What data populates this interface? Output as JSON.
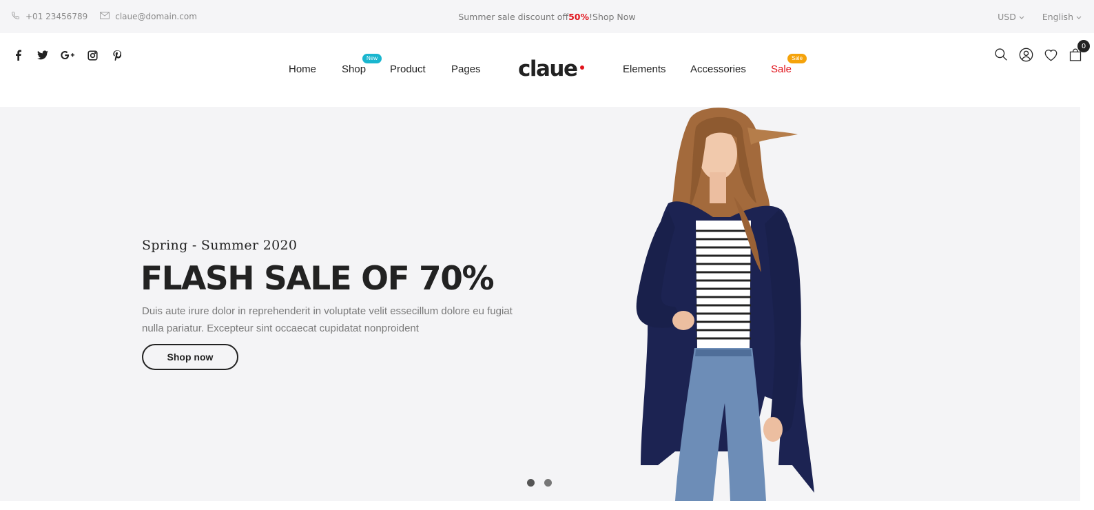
{
  "topbar": {
    "phone": "+01 23456789",
    "email": "claue@domain.com",
    "promo_prefix": "Summer sale discount off ",
    "promo_highlight": "50%",
    "promo_suffix": "! ",
    "promo_link": "Shop Now",
    "currency": "USD",
    "language": "English"
  },
  "header": {
    "social_icons": [
      "facebook-icon",
      "twitter-icon",
      "google-plus-icon",
      "instagram-icon",
      "pinterest-icon"
    ],
    "logo": "claue",
    "nav_left": [
      {
        "label": "Home"
      },
      {
        "label": "Shop",
        "badge": "New"
      },
      {
        "label": "Product"
      },
      {
        "label": "Pages"
      }
    ],
    "nav_right": [
      {
        "label": "Elements"
      },
      {
        "label": "Accessories"
      },
      {
        "label": "Sale",
        "badge": "Sale"
      }
    ],
    "icons": [
      "search-icon",
      "user-icon",
      "heart-icon",
      "cart-icon"
    ],
    "cart_count": "0"
  },
  "hero": {
    "subtitle": "Spring - Summer 2020",
    "title": "FLASH SALE OF 70%",
    "description": "Duis aute irure dolor in reprehenderit in voluptate velit essecillum dolore eu fugiat nulla pariatur. Excepteur sint occaecat cupidatat nonproident",
    "button": "Shop now",
    "slides": 2,
    "active_slide": 1
  },
  "colors": {
    "accent_red": "#e1131b",
    "badge_new": "#19b6cf",
    "badge_sale": "#f5a30b",
    "hero_bg": "#f4f4f6",
    "topbar_bg": "#f5f5f7"
  }
}
